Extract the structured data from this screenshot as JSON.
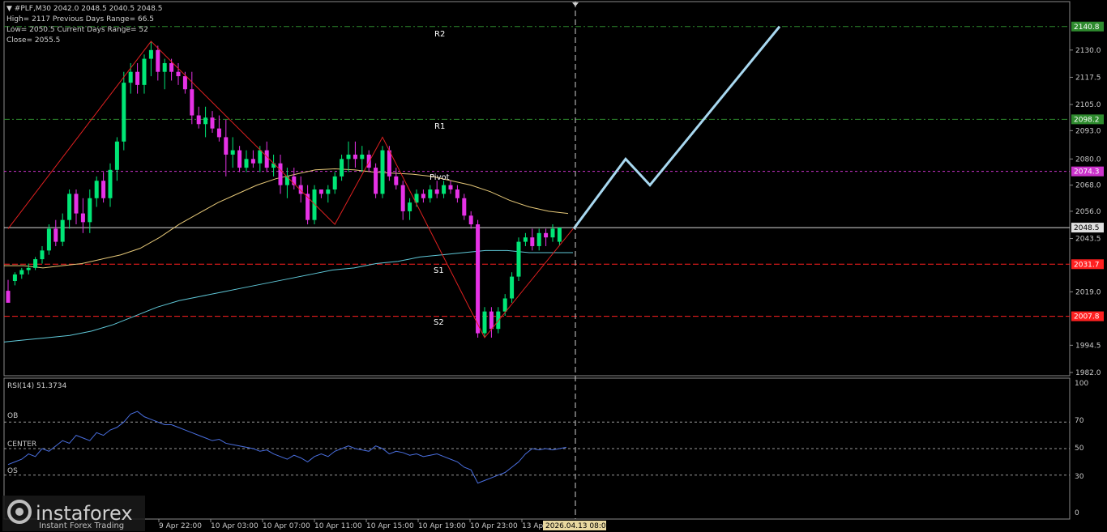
{
  "header": {
    "symbol_line": "▼ #PLF,M30  2042.0 2048.5 2040.5 2048.5",
    "line2": "High= 2117   Previous Days Range= 66.5",
    "line3": "Low= 2050.5   Current Days Range= 52",
    "line4": "Close= 2055.5"
  },
  "rsi_panel": {
    "title": "RSI(14) 51.3734",
    "labels": {
      "ob": "OB",
      "center": "CENTER",
      "os": "OS"
    },
    "scale": [
      "100",
      "70",
      "50",
      "30",
      "0"
    ]
  },
  "levels": {
    "r2": {
      "name": "R2",
      "price": "2140.8",
      "color": "#2e8b2e"
    },
    "r1": {
      "name": "R1",
      "price": "2098.2",
      "color": "#2e8b2e"
    },
    "pivot": {
      "name": "Pivot",
      "price": "2074.3",
      "color": "#cc33cc"
    },
    "current": {
      "price": "2048.5",
      "color": "#d9d9d9"
    },
    "s1": {
      "name": "S1",
      "price": "2031.7",
      "color": "#ff2020"
    },
    "s2": {
      "name": "S2",
      "price": "2007.8",
      "color": "#ff2020"
    }
  },
  "price_axis": [
    "2130.0",
    "2117.5",
    "2105.0",
    "2093.0",
    "2080.0",
    "2068.0",
    "2056.0",
    "2043.5",
    "2019.0",
    "1994.5",
    "1982.0"
  ],
  "time_axis": [
    "9 Apr 22:00",
    "10 Apr 03:00",
    "10 Apr 07:00",
    "10 Apr 11:00",
    "10 Apr 15:00",
    "10 Apr 19:00",
    "10 Apr 23:00",
    "13 Ap"
  ],
  "time_cursor": "2026.04.13 08:00",
  "watermark": {
    "brand": "instaforex",
    "tagline": "Instant Forex Trading"
  },
  "colors": {
    "bull": "#00e676",
    "bear": "#e632e6",
    "ma_fast": "#e6c878",
    "ma_slow": "#5fc8d8",
    "zigzag": "#e02020",
    "forecast": "#a8d8f0",
    "rsi": "#4a6fe0"
  },
  "chart_data": {
    "type": "candlestick",
    "ylim": [
      1982,
      2150
    ],
    "ohlc": [
      [
        2019.5,
        2024.5,
        2016,
        2014
      ],
      [
        2024,
        2028,
        2022,
        2027
      ],
      [
        2027,
        2030,
        2025,
        2029
      ],
      [
        2029,
        2032,
        2027,
        2030
      ],
      [
        2030,
        2035,
        2029,
        2034
      ],
      [
        2034,
        2040,
        2032,
        2038
      ],
      [
        2038,
        2050,
        2036,
        2048
      ],
      [
        2048,
        2052,
        2040,
        2042
      ],
      [
        2042,
        2055,
        2040,
        2052
      ],
      [
        2052,
        2066,
        2048,
        2064
      ],
      [
        2064,
        2066,
        2050,
        2055
      ],
      [
        2055,
        2062,
        2046,
        2051
      ],
      [
        2051,
        2066,
        2046,
        2062
      ],
      [
        2062,
        2072,
        2058,
        2070
      ],
      [
        2070,
        2074,
        2060,
        2062
      ],
      [
        2062,
        2078,
        2058,
        2075
      ],
      [
        2075,
        2090,
        2070,
        2088
      ],
      [
        2088,
        2120,
        2084,
        2115
      ],
      [
        2115,
        2124,
        2110,
        2120
      ],
      [
        2120,
        2124,
        2110,
        2114
      ],
      [
        2114,
        2128,
        2110,
        2126
      ],
      [
        2126,
        2134,
        2118,
        2130
      ],
      [
        2130,
        2132,
        2116,
        2120
      ],
      [
        2120,
        2126,
        2112,
        2124
      ],
      [
        2124,
        2126,
        2116,
        2120
      ],
      [
        2120,
        2124,
        2114,
        2118
      ],
      [
        2118,
        2120,
        2110,
        2112
      ],
      [
        2112,
        2120,
        2096,
        2100
      ],
      [
        2100,
        2104,
        2094,
        2096
      ],
      [
        2096,
        2104,
        2090,
        2099
      ],
      [
        2099,
        2102,
        2092,
        2094
      ],
      [
        2094,
        2100,
        2088,
        2090
      ],
      [
        2090,
        2098,
        2072,
        2082
      ],
      [
        2082,
        2090,
        2076,
        2084
      ],
      [
        2084,
        2086,
        2074,
        2076
      ],
      [
        2076,
        2084,
        2074,
        2080
      ],
      [
        2080,
        2084,
        2076,
        2078
      ],
      [
        2078,
        2086,
        2074,
        2084
      ],
      [
        2084,
        2088,
        2074,
        2076
      ],
      [
        2076,
        2082,
        2072,
        2078
      ],
      [
        2078,
        2082,
        2064,
        2068
      ],
      [
        2068,
        2076,
        2062,
        2072
      ],
      [
        2072,
        2076,
        2066,
        2068
      ],
      [
        2068,
        2072,
        2060,
        2064
      ],
      [
        2064,
        2068,
        2050,
        2052
      ],
      [
        2052,
        2068,
        2050,
        2066
      ],
      [
        2066,
        2066,
        2062,
        2064
      ],
      [
        2064,
        2068,
        2060,
        2066
      ],
      [
        2066,
        2074,
        2064,
        2072
      ],
      [
        2072,
        2082,
        2070,
        2080
      ],
      [
        2080,
        2088,
        2074,
        2082
      ],
      [
        2082,
        2088,
        2076,
        2080
      ],
      [
        2080,
        2086,
        2074,
        2082
      ],
      [
        2082,
        2084,
        2074,
        2076
      ],
      [
        2076,
        2078,
        2062,
        2064
      ],
      [
        2064,
        2086,
        2062,
        2084
      ],
      [
        2084,
        2086,
        2070,
        2072
      ],
      [
        2072,
        2076,
        2066,
        2068
      ],
      [
        2068,
        2070,
        2052,
        2056
      ],
      [
        2056,
        2062,
        2052,
        2060
      ],
      [
        2060,
        2066,
        2058,
        2064
      ],
      [
        2064,
        2066,
        2060,
        2062
      ],
      [
        2062,
        2068,
        2060,
        2066
      ],
      [
        2066,
        2070,
        2062,
        2064
      ],
      [
        2064,
        2070,
        2062,
        2068
      ],
      [
        2068,
        2070,
        2064,
        2066
      ],
      [
        2066,
        2068,
        2060,
        2062
      ],
      [
        2062,
        2064,
        2052,
        2054
      ],
      [
        2054,
        2056,
        2048,
        2050
      ],
      [
        2050,
        2052,
        1998,
        2000
      ],
      [
        2000,
        2012,
        1998,
        2010
      ],
      [
        2010,
        2012,
        1998,
        2002
      ],
      [
        2002,
        2012,
        2000,
        2010
      ],
      [
        2010,
        2018,
        2008,
        2016
      ],
      [
        2016,
        2028,
        2014,
        2026
      ],
      [
        2026,
        2044,
        2024,
        2042
      ],
      [
        2042,
        2046,
        2040,
        2044
      ],
      [
        2044,
        2048,
        2038,
        2040
      ],
      [
        2040,
        2048,
        2038,
        2046
      ],
      [
        2046,
        2048,
        2040,
        2044
      ],
      [
        2044,
        2050,
        2042,
        2048
      ],
      [
        2042,
        2048.5,
        2040.5,
        2048.5
      ]
    ],
    "ma_fast": [
      2031,
      2031,
      2030,
      2031,
      2032,
      2034,
      2036,
      2039,
      2044,
      2050,
      2055,
      2060,
      2064,
      2068,
      2071,
      2073,
      2075,
      2075.5,
      2075,
      2074,
      2073.5,
      2073,
      2072,
      2070,
      2068,
      2065,
      2061,
      2058,
      2056,
      2055
    ],
    "ma_slow": [
      1996,
      1997,
      1998,
      1999,
      2001,
      2004,
      2008,
      2012,
      2015,
      2017,
      2019,
      2021,
      2023,
      2025,
      2027,
      2029,
      2030,
      2032,
      2033,
      2035,
      2036,
      2037,
      2038,
      2038,
      2037,
      2037,
      2037
    ],
    "zigzag": [
      [
        0,
        2048
      ],
      [
        21,
        2134
      ],
      [
        48,
        2050
      ],
      [
        55,
        2090
      ],
      [
        70,
        1998
      ],
      [
        83,
        2048
      ]
    ],
    "forecast": [
      [
        2048,
        "start"
      ],
      [
        2080,
        "up"
      ],
      [
        2068,
        "pullback"
      ],
      [
        2140.8,
        "target"
      ]
    ],
    "rsi": [
      38,
      40,
      42,
      46,
      44,
      50,
      48,
      52,
      56,
      54,
      60,
      58,
      56,
      62,
      60,
      64,
      66,
      70,
      76,
      78,
      74,
      72,
      70,
      68,
      68,
      66,
      64,
      62,
      60,
      58,
      56,
      57,
      54,
      53,
      52,
      51,
      50,
      48,
      49,
      46,
      44,
      42,
      45,
      43,
      40,
      44,
      46,
      44,
      48,
      50,
      52,
      50,
      49,
      48,
      52,
      50,
      46,
      48,
      47,
      45,
      46,
      44,
      45,
      46,
      44,
      42,
      40,
      36,
      34,
      24,
      26,
      28,
      30,
      32,
      36,
      40,
      46,
      50,
      49,
      50,
      49,
      50,
      51
    ]
  }
}
